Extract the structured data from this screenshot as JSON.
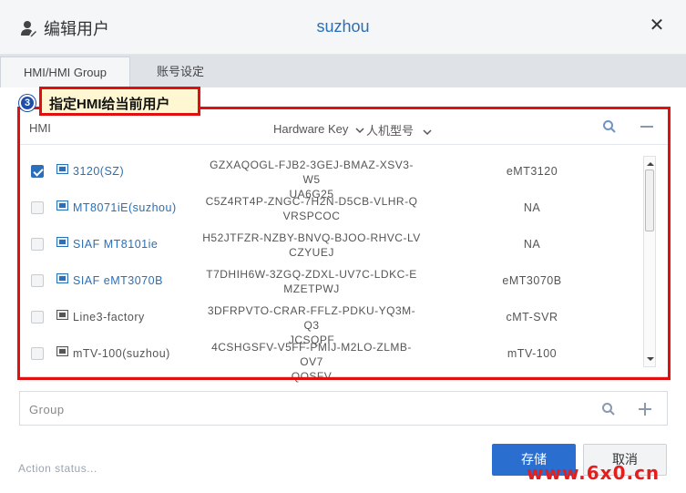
{
  "dialog": {
    "title": "编辑用户",
    "user_name": "suzhou",
    "close_label": "✕"
  },
  "tabs": [
    {
      "label": "HMI/HMI Group",
      "active": true
    },
    {
      "label": "账号设定",
      "active": false
    }
  ],
  "callout": {
    "number": "3",
    "text": "指定HMI给当前用户"
  },
  "hmi_panel": {
    "label": "HMI",
    "col_hardware_key": "Hardware Key",
    "col_model": "人机型号",
    "rows": [
      {
        "checked": true,
        "name": "3120(SZ)",
        "icon": "hmi-online-icon",
        "key_line1": "GZXAQOGL-FJB2-3GEJ-BMAZ-XSV3-W5",
        "key_line2": "UA6G25",
        "model": "eMT3120"
      },
      {
        "checked": false,
        "name": "MT8071iE(suzhou)",
        "icon": "hmi-online-icon",
        "key_line1": "C5Z4RT4P-ZNGC-7H2N-D5CB-VLHR-Q",
        "key_line2": "VRSPCOC",
        "model": "NA"
      },
      {
        "checked": false,
        "name": "SIAF MT8101ie",
        "icon": "hmi-online-icon",
        "key_line1": "H52JTFZR-NZBY-BNVQ-BJOO-RHVC-LV",
        "key_line2": "CZYUEJ",
        "model": "NA"
      },
      {
        "checked": false,
        "name": "SIAF eMT3070B",
        "icon": "hmi-online-icon",
        "key_line1": "T7DHIH6W-3ZGQ-ZDXL-UV7C-LDKC-E",
        "key_line2": "MZETPWJ",
        "model": "eMT3070B"
      },
      {
        "checked": false,
        "name": "Line3-factory",
        "icon": "hmi-offline-icon",
        "key_line1": "3DFRPVTO-CRAR-FFLZ-PDKU-YQ3M-Q3",
        "key_line2": "JCSQPF",
        "model": "cMT-SVR"
      },
      {
        "checked": false,
        "name": "mTV-100(suzhou)",
        "icon": "hmi-offline-icon",
        "key_line1": "4CSHGSFV-V5FF-PMIJ-M2LO-ZLMB-OV7",
        "key_line2": "QOSFV",
        "model": "mTV-100"
      }
    ]
  },
  "group_panel": {
    "label": "Group"
  },
  "footer": {
    "status": "Action status...",
    "save_label": "存储",
    "cancel_label": "取消"
  },
  "watermark": "www.6x0.cn",
  "colors": {
    "accent": "#2a6fb7",
    "highlight": "#e01010",
    "callout_bg": "#fff7d1"
  }
}
